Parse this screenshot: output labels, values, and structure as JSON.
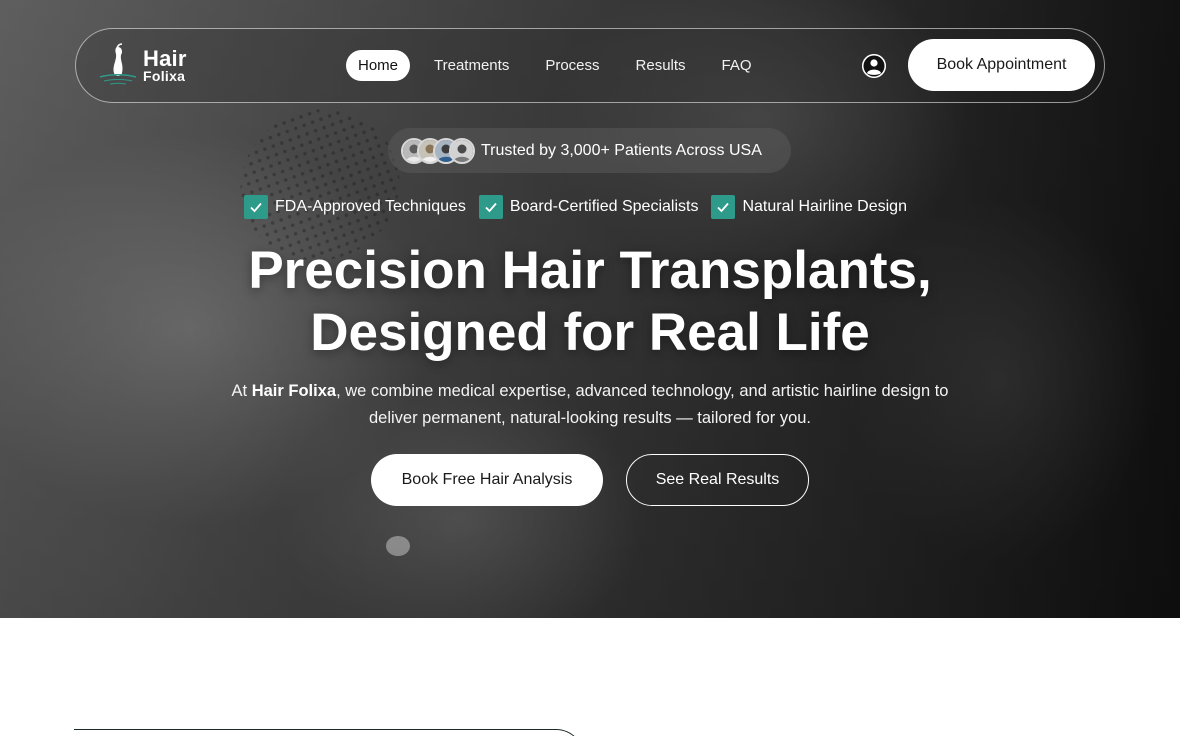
{
  "brand": {
    "name_line1": "Hair",
    "name_line2": "Folixa",
    "accent": "#2e9a8a"
  },
  "nav": {
    "items": [
      {
        "label": "Home",
        "active": true
      },
      {
        "label": "Treatments",
        "active": false
      },
      {
        "label": "Process",
        "active": false
      },
      {
        "label": "Results",
        "active": false
      },
      {
        "label": "FAQ",
        "active": false
      }
    ],
    "user_icon": "user-circle-icon",
    "book_label": "Book Appointment"
  },
  "hero": {
    "trust_text": "Trusted by 3,000+ Patients Across USA",
    "badges": [
      "FDA-Approved Techniques",
      "Board-Certified Specialists",
      "Natural Hairline Design"
    ],
    "headline_line1": "Precision Hair Transplants,",
    "headline_line2": "Designed for Real Life",
    "sub_prefix": "At ",
    "sub_brand": "Hair Folixa",
    "sub_rest": ", we combine medical expertise, advanced technology, and artistic hairline design to deliver permanent, natural-looking results — tailored for you.",
    "primary_cta": "Book Free Hair Analysis",
    "secondary_cta": "See Real Results"
  }
}
